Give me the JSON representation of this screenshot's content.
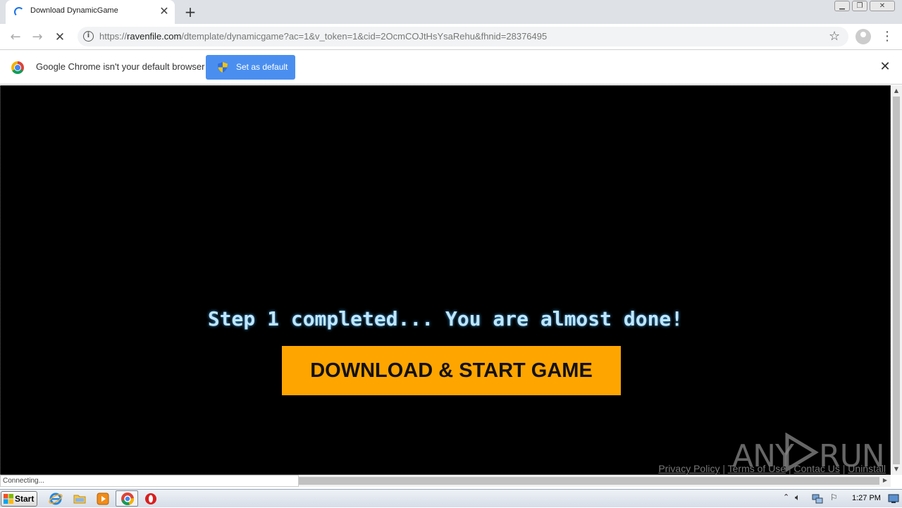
{
  "browser": {
    "tab_title": "Download DynamicGame",
    "new_tab_symbol": "+",
    "tab_close_symbol": "✕",
    "url_scheme": "https://",
    "url_host": "ravenfile.com",
    "url_path": "/dtemplate/dynamicgame?ac=1&v_token=1&cid=2OcmCOJtHsYsaRehu&fhnid=28376495",
    "window_controls": [
      "minimize",
      "restore",
      "close"
    ]
  },
  "infobar": {
    "message": "Google Chrome isn't your default browser",
    "button_label": "Set as default",
    "close_symbol": "✕"
  },
  "page": {
    "step_text": "Step 1 completed... You are almost done!",
    "cta_label": "DOWNLOAD & START GAME",
    "footer_links": [
      "Privacy Policy",
      "Terms of Use",
      "Contac Us",
      "Uninstall"
    ],
    "footer_separator": "|",
    "watermark_left": "ANY",
    "watermark_right": "RUN"
  },
  "status_bar": {
    "text": "Connecting..."
  },
  "taskbar": {
    "start_label": "Start",
    "icons": [
      "internet-explorer-icon",
      "folder-icon",
      "media-player-icon",
      "chrome-icon",
      "opera-icon"
    ],
    "clock": "1:27 PM"
  },
  "colors": {
    "cta_background": "#ffa500",
    "step_text": "#bfe6ff",
    "infobar_button": "#4a8ff0",
    "viewport_background": "#000000"
  }
}
